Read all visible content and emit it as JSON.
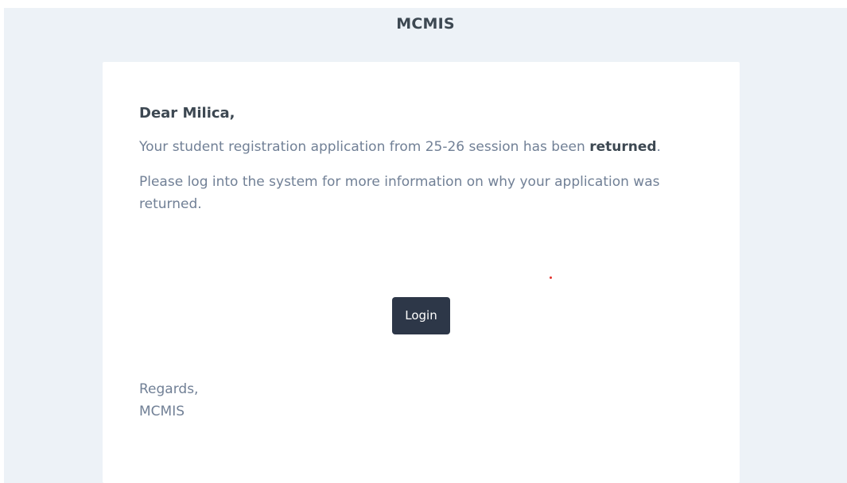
{
  "header": {
    "title": "MCMIS"
  },
  "email": {
    "greeting": "Dear Milica,",
    "line1_prefix": "Your student registration application from 25-26 session has been ",
    "line1_emphasis": "returned",
    "line1_suffix": ".",
    "line2": "Please log into the system for more information on why your application was returned.",
    "button_label": "Login",
    "closing": "Regards,",
    "signature": "MCMIS"
  },
  "colors": {
    "page_bg": "#edf2f7",
    "card_bg": "#ffffff",
    "button_bg": "#2d3748",
    "text_muted": "#718096",
    "text_dark": "#3d4852"
  }
}
